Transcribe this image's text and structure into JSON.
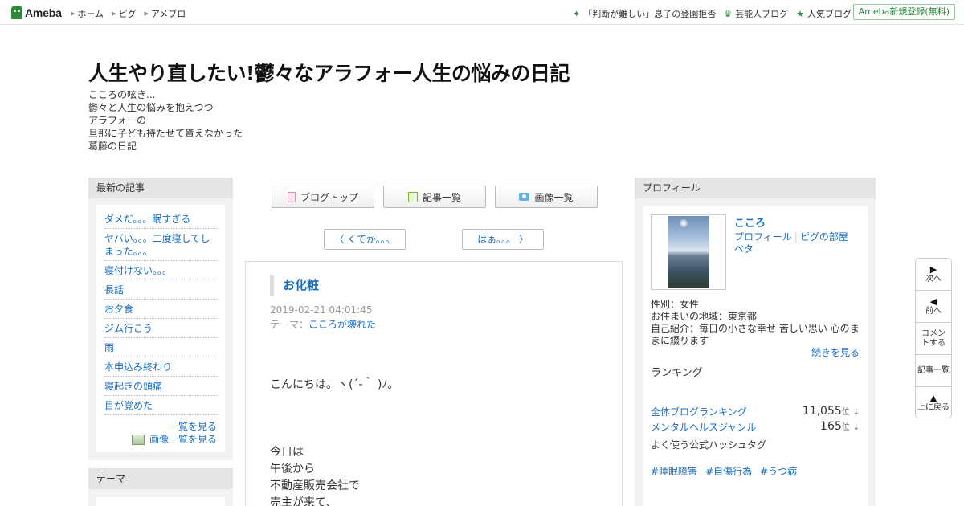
{
  "header": {
    "logo": "Ameba",
    "nav": [
      "ホーム",
      "ピグ",
      "アメブロ"
    ],
    "links": [
      {
        "icon": "sparkle-icon",
        "label": "「判断が難しい」息子の登園拒否"
      },
      {
        "icon": "crown-icon",
        "label": "芸能人ブログ"
      },
      {
        "icon": "star-icon",
        "label": "人気ブログ"
      }
    ],
    "register": "Ameba新規登録(無料)"
  },
  "blog": {
    "title": "人生やり直したい!鬱々なアラフォー人生の悩みの日記",
    "description": [
      "こころの呟き...",
      "鬱々と人生の悩みを抱えつつ",
      "アラフォーの",
      "旦那に子ども持たせて貰えなかった",
      "葛藤の日記"
    ]
  },
  "left": {
    "recent_heading": "最新の記事",
    "articles": [
      "ダメだ。。。眠すぎる",
      "ヤバい。。。二度寝してしまった。。。",
      "寝付けない。。。",
      "長話",
      "お夕食",
      "ジム行こう",
      "雨",
      "本申込み終わり",
      "寝起きの頭痛",
      "目が覚めた"
    ],
    "see_list": "一覧を見る",
    "see_images": "画像一覧を見る",
    "theme_heading": "テーマ"
  },
  "main": {
    "tabs": [
      "ブログトップ",
      "記事一覧",
      "画像一覧"
    ],
    "prev": "くてか。。。",
    "next": "はぁ。。。",
    "entry": {
      "title": "お化粧",
      "date": "2019-02-21 04:01:45",
      "theme_label": "テーマ：",
      "theme": "こころが壊れた",
      "body": [
        "こんにちは。ヽ(´-｀ )ﾉ。",
        "",
        "",
        "",
        "今日は",
        "午後から",
        "不動産販売会社で",
        "売主が来て、"
      ]
    }
  },
  "right": {
    "profile_heading": "プロフィール",
    "name": "こころ",
    "link_profile": "プロフィール",
    "link_pig": "ピグの部屋",
    "link_peta": "ペタ",
    "gender": "性別：女性",
    "area": "お住まいの地域：東京都",
    "intro": "自己紹介：毎日の小さな幸せ 苦しい思い 心のままに綴ります",
    "more": "続きを見る",
    "ranking_heading": "ランキング",
    "rankings": [
      {
        "label": "全体ブログランキング",
        "value": "11,055",
        "unit": "位",
        "trend": "↓"
      },
      {
        "label": "メンタルヘルスジャンル",
        "value": "165",
        "unit": "位",
        "trend": "↓"
      }
    ],
    "hashtag_heading": "よく使う公式ハッシュタグ",
    "hashtags": [
      "#睡眠障害",
      "#自傷行為",
      "#うつ病"
    ]
  },
  "float_nav": {
    "next": "次へ",
    "prev": "前へ",
    "comment": "コメントする",
    "list": "記事一覧",
    "top": "上に戻る"
  }
}
